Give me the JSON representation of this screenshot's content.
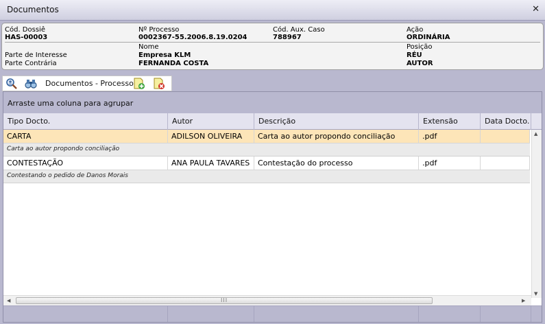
{
  "window": {
    "title": "Documentos",
    "close_glyph": "✕"
  },
  "info": {
    "cod_dossie": {
      "label": "Cód. Dossiê",
      "value": "HAS-00003"
    },
    "num_processo": {
      "label": "Nº Processo",
      "value": "0002367-55.2006.8.19.0204"
    },
    "cod_aux_caso": {
      "label": "Cód. Aux. Caso",
      "value": "788967"
    },
    "acao": {
      "label": "Ação",
      "value": "ORDINÁRIA"
    },
    "nome_label": "Nome",
    "posicao_label": "Posição",
    "parte_interesse": {
      "label": "Parte de Interesse",
      "nome": "Empresa KLM",
      "posicao": "RÉU"
    },
    "parte_contraria": {
      "label": "Parte Contrária",
      "nome": "FERNANDA COSTA",
      "posicao": "AUTOR"
    }
  },
  "toolbar": {
    "label": "Documentos - Processo",
    "icons": [
      "search-person-icon",
      "binoculars-icon",
      "add-document-icon",
      "delete-document-icon"
    ]
  },
  "grid": {
    "group_hint": "Arraste uma coluna para agrupar",
    "columns": [
      "Tipo Docto.",
      "Autor",
      "Descrição",
      "Extensão",
      "Data Docto."
    ],
    "rows": [
      {
        "tipo": "CARTA",
        "autor": "ADILSON OLIVEIRA",
        "descricao": "Carta ao autor propondo conciliação",
        "extensao": ".pdf",
        "data": "",
        "preview": "Carta ao autor propondo conciliação",
        "selected": true
      },
      {
        "tipo": "CONTESTAÇÃO",
        "autor": "ANA PAULA TAVARES",
        "descricao": "Contestação do processo",
        "extensao": ".pdf",
        "data": "",
        "preview": "Contestando o pedido de Danos Morais",
        "selected": false
      }
    ],
    "scroll_grip": "III"
  },
  "colors": {
    "background": "#b9b8cf",
    "selected_row": "#fde5b8",
    "header": "#e4e3ef"
  }
}
